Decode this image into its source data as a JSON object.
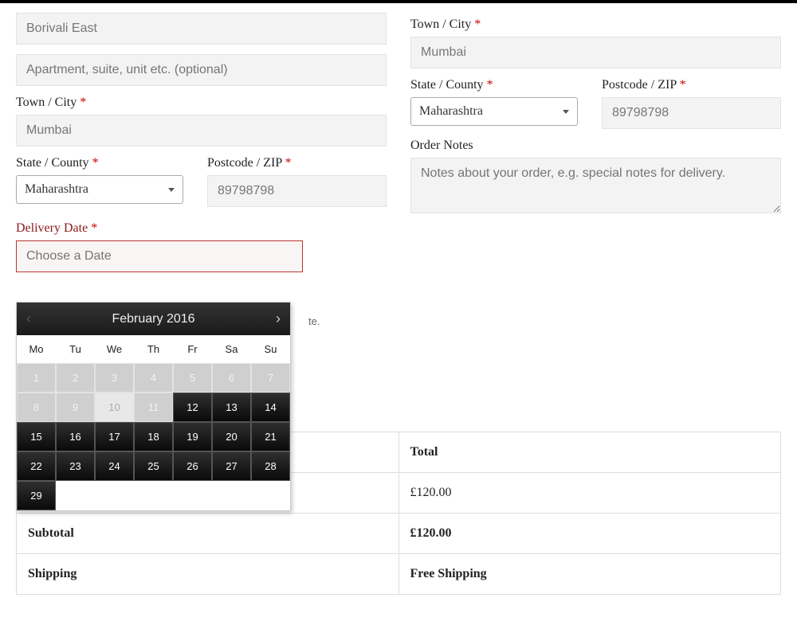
{
  "billing": {
    "street1": "Borivali East",
    "street2_placeholder": "Apartment, suite, unit etc. (optional)",
    "city_label": "Town / City",
    "city": "Mumbai",
    "state_label": "State / County",
    "state": "Maharashtra",
    "postcode_label": "Postcode / ZIP",
    "postcode": "89798798"
  },
  "shipping": {
    "city_label": "Town / City",
    "city": "Mumbai",
    "state_label": "State / County",
    "state": "Maharashtra",
    "postcode_label": "Postcode / ZIP",
    "postcode": "89798798",
    "notes_label": "Order Notes",
    "notes_placeholder": "Notes about your order, e.g. special notes for delivery."
  },
  "delivery": {
    "label": "Delivery Date",
    "placeholder": "Choose a Date",
    "hint_fragment": "te."
  },
  "calendar": {
    "title": "February 2016",
    "dow": [
      "Mo",
      "Tu",
      "We",
      "Th",
      "Fr",
      "Sa",
      "Su"
    ],
    "disabled": [
      1,
      2,
      3,
      4,
      5,
      6,
      7,
      8,
      9,
      11
    ],
    "today": 10,
    "last_day": 29
  },
  "order": {
    "header_total": "Total",
    "row1_price": "£120.00",
    "subtotal_label": "Subtotal",
    "subtotal_value": "£120.00",
    "shipping_label": "Shipping",
    "shipping_value": "Free Shipping"
  },
  "asterisk": "*"
}
